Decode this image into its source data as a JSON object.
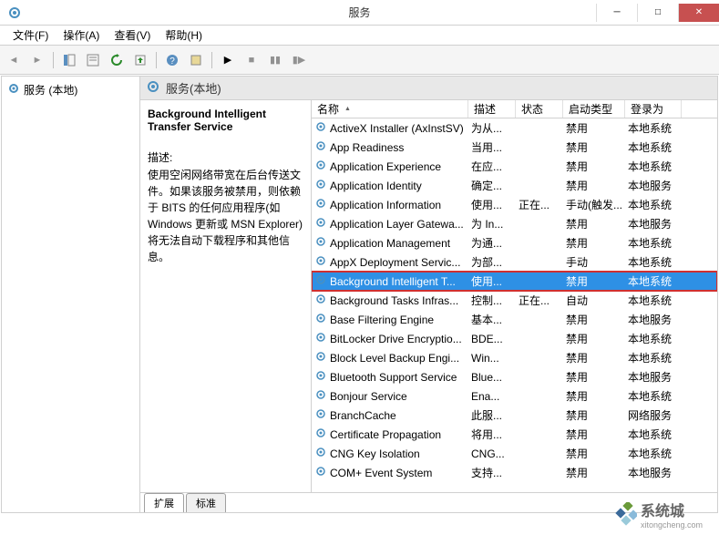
{
  "window": {
    "title": "服务"
  },
  "menu": {
    "file": "文件(F)",
    "action": "操作(A)",
    "view": "查看(V)",
    "help": "帮助(H)"
  },
  "tree": {
    "root": "服务 (本地)"
  },
  "content_header": {
    "title": "服务(本地)"
  },
  "detail": {
    "name": "Background Intelligent Transfer Service",
    "desc_label": "描述:",
    "desc_text": "使用空闲网络带宽在后台传送文件。如果该服务被禁用，则依赖于 BITS 的任何应用程序(如 Windows 更新或 MSN Explorer)将无法自动下载程序和其他信息。"
  },
  "columns": {
    "name": "名称",
    "desc": "描述",
    "status": "状态",
    "startup": "启动类型",
    "logon": "登录为"
  },
  "services": [
    {
      "name": "ActiveX Installer (AxInstSV)",
      "desc": "为从...",
      "status": "",
      "startup": "禁用",
      "logon": "本地系统"
    },
    {
      "name": "App Readiness",
      "desc": "当用...",
      "status": "",
      "startup": "禁用",
      "logon": "本地系统"
    },
    {
      "name": "Application Experience",
      "desc": "在应...",
      "status": "",
      "startup": "禁用",
      "logon": "本地系统"
    },
    {
      "name": "Application Identity",
      "desc": "确定...",
      "status": "",
      "startup": "禁用",
      "logon": "本地服务"
    },
    {
      "name": "Application Information",
      "desc": "使用...",
      "status": "正在...",
      "startup": "手动(触发...",
      "logon": "本地系统"
    },
    {
      "name": "Application Layer Gatewa...",
      "desc": "为 In...",
      "status": "",
      "startup": "禁用",
      "logon": "本地服务"
    },
    {
      "name": "Application Management",
      "desc": "为通...",
      "status": "",
      "startup": "禁用",
      "logon": "本地系统"
    },
    {
      "name": "AppX Deployment Servic...",
      "desc": "为部...",
      "status": "",
      "startup": "手动",
      "logon": "本地系统"
    },
    {
      "name": "Background Intelligent T...",
      "desc": "使用...",
      "status": "",
      "startup": "禁用",
      "logon": "本地系统",
      "selected": true
    },
    {
      "name": "Background Tasks Infras...",
      "desc": "控制...",
      "status": "正在...",
      "startup": "自动",
      "logon": "本地系统"
    },
    {
      "name": "Base Filtering Engine",
      "desc": "基本...",
      "status": "",
      "startup": "禁用",
      "logon": "本地服务"
    },
    {
      "name": "BitLocker Drive Encryptio...",
      "desc": "BDE...",
      "status": "",
      "startup": "禁用",
      "logon": "本地系统"
    },
    {
      "name": "Block Level Backup Engi...",
      "desc": "Win...",
      "status": "",
      "startup": "禁用",
      "logon": "本地系统"
    },
    {
      "name": "Bluetooth Support Service",
      "desc": "Blue...",
      "status": "",
      "startup": "禁用",
      "logon": "本地服务"
    },
    {
      "name": "Bonjour Service",
      "desc": "Ena...",
      "status": "",
      "startup": "禁用",
      "logon": "本地系统"
    },
    {
      "name": "BranchCache",
      "desc": "此服...",
      "status": "",
      "startup": "禁用",
      "logon": "网络服务"
    },
    {
      "name": "Certificate Propagation",
      "desc": "将用...",
      "status": "",
      "startup": "禁用",
      "logon": "本地系统"
    },
    {
      "name": "CNG Key Isolation",
      "desc": "CNG...",
      "status": "",
      "startup": "禁用",
      "logon": "本地系统"
    },
    {
      "name": "COM+ Event System",
      "desc": "支持...",
      "status": "",
      "startup": "禁用",
      "logon": "本地服务"
    }
  ],
  "tabs": {
    "extended": "扩展",
    "standard": "标准"
  },
  "watermark": {
    "text": "系统城",
    "url": "xitongcheng.com"
  }
}
